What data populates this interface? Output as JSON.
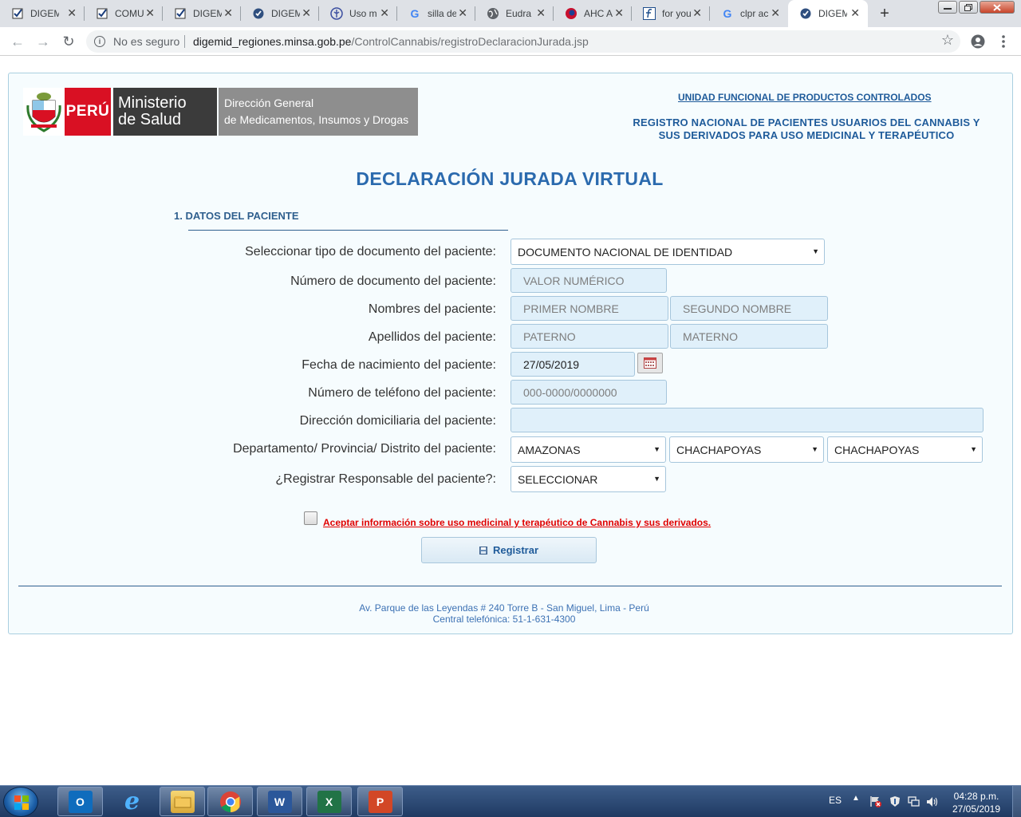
{
  "browser": {
    "tabs": [
      {
        "title": "DIGEM",
        "icon": "check-box-icon",
        "active": false
      },
      {
        "title": "COMU",
        "icon": "check-box-icon",
        "active": false
      },
      {
        "title": "DIGEM",
        "icon": "check-box-icon",
        "active": false
      },
      {
        "title": "DIGEM",
        "icon": "blue-check-icon",
        "active": false
      },
      {
        "title": "Uso m",
        "icon": "medical-logo-icon",
        "active": false
      },
      {
        "title": "silla de",
        "icon": "google-icon",
        "active": false
      },
      {
        "title": "Eudra",
        "icon": "globe-icon",
        "active": false
      },
      {
        "title": "AHC A",
        "icon": "ahc-logo-icon",
        "active": false
      },
      {
        "title": "for you",
        "icon": "formula-icon",
        "active": false
      },
      {
        "title": "clpr ac",
        "icon": "google-icon",
        "active": false
      },
      {
        "title": "DIGEM",
        "icon": "blue-check-icon",
        "active": true
      }
    ],
    "close_glyph": "✕",
    "new_tab_glyph": "+",
    "security_label": "No es seguro",
    "url_domain": "digemid_regiones.minsa.gob.pe",
    "url_path": "/ControlCannabis/registroDeclaracionJurada.jsp"
  },
  "header": {
    "logo_peru": "PERÚ",
    "logo_ministerio_1": "Ministerio",
    "logo_ministerio_2": "de Salud",
    "logo_direccion_1": "Dirección General",
    "logo_direccion_2": "de Medicamentos, Insumos y Drogas",
    "unit_link": "UNIDAD FUNCIONAL DE PRODUCTOS CONTROLADOS",
    "registro_line1": "REGISTRO NACIONAL DE PACIENTES USUARIOS DEL CANNABIS Y",
    "registro_line2": "SUS DERIVADOS PARA USO MEDICINAL Y TERAPÉUTICO"
  },
  "form": {
    "title": "DECLARACIÓN JURADA VIRTUAL",
    "section": "1. DATOS DEL PACIENTE",
    "labels": {
      "doc_type": "Seleccionar tipo de documento del paciente:",
      "doc_number": "Número de documento del paciente:",
      "names": "Nombres del paciente:",
      "surnames": "Apellidos del paciente:",
      "birth_date": "Fecha de nacimiento del paciente:",
      "phone": "Número de teléfono del paciente:",
      "address": "Dirección domiciliaria del paciente:",
      "location": "Departamento/ Provincia/ Distrito del paciente:",
      "responsible": "¿Registrar Responsable del paciente?:"
    },
    "doc_type_value": "DOCUMENTO NACIONAL DE IDENTIDAD",
    "doc_number_placeholder": "VALOR NUMÉRICO",
    "first_name_placeholder": "PRIMER NOMBRE",
    "second_name_placeholder": "SEGUNDO NOMBRE",
    "paternal_placeholder": "PATERNO",
    "maternal_placeholder": "MATERNO",
    "birth_date_value": "27/05/2019",
    "phone_placeholder": "000-0000/0000000",
    "address_value": "",
    "department_value": "AMAZONAS",
    "province_value": "CHACHAPOYAS",
    "district_value": "CHACHAPOYAS",
    "responsible_value": "SELECCIONAR",
    "select_arrow": "▼",
    "accept_text": "Aceptar información sobre uso medicinal y terapéutico de Cannabis y sus derivados.",
    "register_label": "Registrar",
    "colors": {
      "accent": "#2b6aae",
      "alert": "#e00000"
    }
  },
  "footer": {
    "address": "Av. Parque de las Leyendas # 240 Torre B - San Miguel, Lima - Perú",
    "phone": "Central telefónica: 51-1-631-4300"
  },
  "taskbar": {
    "apps": [
      "outlook-icon",
      "internet-explorer-icon",
      "file-explorer-icon",
      "chrome-icon",
      "word-icon",
      "excel-icon",
      "powerpoint-icon"
    ],
    "language": "ES",
    "tray_arrow": "▲",
    "time": "04:28 p.m.",
    "date": "27/05/2019"
  }
}
